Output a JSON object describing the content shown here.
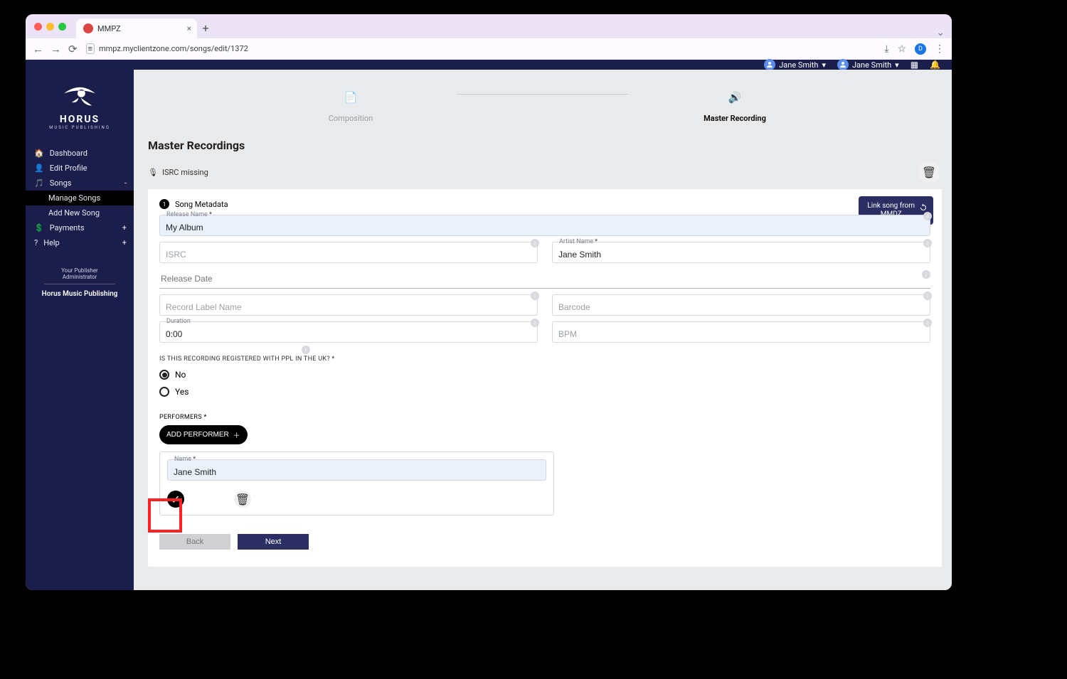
{
  "browser": {
    "tab_title": "MMPZ",
    "url": "mmpz.myclientzone.com/songs/edit/1372",
    "profile_initial": "D"
  },
  "topbar": {
    "user1": "Jane Smith",
    "user2": "Jane Smith"
  },
  "sidebar": {
    "brand": "HORUS",
    "brand_sub": "MUSIC PUBLISHING",
    "items": {
      "dashboard": "Dashboard",
      "edit_profile": "Edit Profile",
      "songs": "Songs",
      "manage_songs": "Manage Songs",
      "add_new_song": "Add New Song",
      "payments": "Payments",
      "help": "Help"
    },
    "pub_admin": "Your Publisher Administrator",
    "pub_name": "Horus Music Publishing"
  },
  "steps": {
    "composition": "Composition",
    "master_recording": "Master Recording"
  },
  "page": {
    "title": "Master Recordings",
    "warning": "ISRC missing",
    "link_btn_line1": "Link song from",
    "link_btn_line2": "MMDZ"
  },
  "section": {
    "num": "1",
    "title": "Song Metadata"
  },
  "fields": {
    "release_name_label": "Release Name",
    "release_name_value": "My Album",
    "isrc_placeholder": "ISRC",
    "artist_name_label": "Artist Name",
    "artist_name_value": "Jane Smith",
    "release_date_placeholder": "Release Date",
    "record_label_placeholder": "Record Label Name",
    "barcode_placeholder": "Barcode",
    "duration_label": "Duration",
    "duration_value": "0:00",
    "bpm_placeholder": "BPM"
  },
  "ppl": {
    "question": "IS THIS RECORDING REGISTERED WITH PPL IN THE UK? *",
    "no": "No",
    "yes": "Yes"
  },
  "performers": {
    "label": "PERFORMERS *",
    "add_btn": "ADD PERFORMER",
    "name_label": "Name",
    "name_value": "Jane Smith"
  },
  "nav": {
    "back": "Back",
    "next": "Next"
  }
}
